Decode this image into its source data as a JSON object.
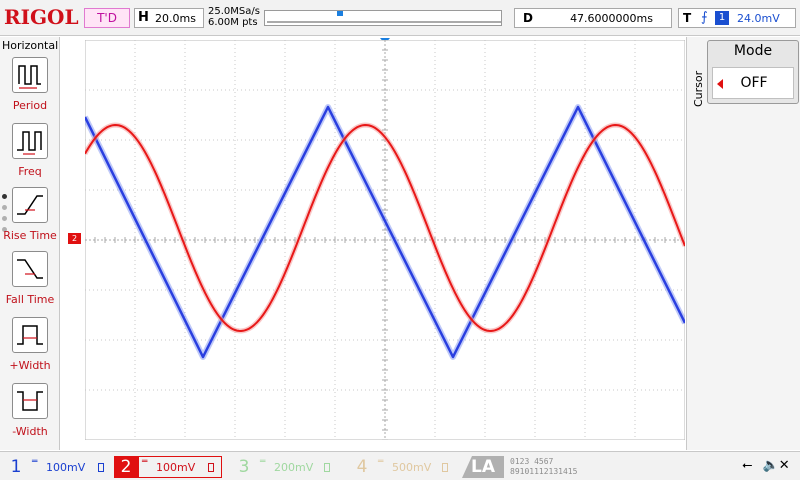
{
  "brand": "RIGOL",
  "top": {
    "trigger_status": "T'D",
    "horizontal": {
      "label": "H",
      "value": "20.0ms"
    },
    "sample_rate": "25.0MSa/s",
    "memory_depth": "6.00M pts",
    "delay": {
      "label": "D",
      "value": "47.6000000ms"
    },
    "trigger": {
      "label": "T",
      "edge": "rising",
      "source": "1",
      "level": "24.0mV"
    }
  },
  "left_panel": {
    "title": "Horizontal",
    "items": [
      {
        "label": "Period",
        "icon": "period-icon"
      },
      {
        "label": "Freq",
        "icon": "freq-icon"
      },
      {
        "label": "Rise Time",
        "icon": "rise-time-icon"
      },
      {
        "label": "Fall Time",
        "icon": "fall-time-icon"
      },
      {
        "label": "+Width",
        "icon": "positive-width-icon"
      },
      {
        "label": "-Width",
        "icon": "negative-width-icon"
      }
    ]
  },
  "menu": {
    "title": "Cursor",
    "mode_label": "Mode",
    "mode_value": "OFF"
  },
  "markers": {
    "ch2": "2",
    "trigger": "T",
    "time_position": "T"
  },
  "channels": [
    {
      "num": "1",
      "coupling": "DC",
      "scale": "100mV",
      "color": "#1a3fd0",
      "active": true
    },
    {
      "num": "2",
      "coupling": "DC",
      "scale": "100mV",
      "color": "#e01010",
      "active": true
    },
    {
      "num": "3",
      "coupling": "DC",
      "scale": "200mV",
      "color": "#a0d8a0",
      "active": false
    },
    {
      "num": "4",
      "coupling": "DC",
      "scale": "500mV",
      "color": "#e0c8a0",
      "active": false
    }
  ],
  "la": {
    "label": "LA",
    "bits_top": "0123 4567",
    "bits_bottom": "89101112131415"
  },
  "colors": {
    "ch1": "#2a3fe0",
    "ch2": "#e81818",
    "grid": "#c8c8c8"
  }
}
